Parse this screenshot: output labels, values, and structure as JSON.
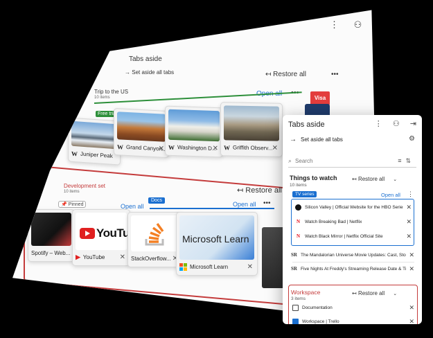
{
  "back": {
    "menu_icons": [
      "⋮",
      "⚇"
    ],
    "title": "Tabs aside",
    "set_aside_label": "Set aside all tabs",
    "restore_all": "Restore all",
    "more": "•••",
    "group1": {
      "name": "Trip to the US",
      "count": "10 items",
      "open_all": "Open all",
      "tag": "Free trials",
      "cards": [
        {
          "fav": "W",
          "title": "Juniper Peak",
          "thumb": "t-mtn"
        },
        {
          "fav": "W",
          "title": "Grand Canyon...",
          "thumb": "t-canyon"
        },
        {
          "fav": "W",
          "title": "Washington D...",
          "thumb": "t-capitol"
        },
        {
          "fav": "W",
          "title": "Griffith Observ...",
          "thumb": "t-griffith"
        }
      ]
    },
    "visa": "Visa",
    "group2": {
      "name": "Development set",
      "count": "10 items",
      "restore_all": "Restore all",
      "pinned": "Pinned",
      "open_all_1": "Open all",
      "docs_tag": "Docs",
      "open_all_2": "Open all",
      "cards": [
        {
          "title": "Spotify – Web...",
          "thumb": "t-spotify"
        },
        {
          "title": "YouTube",
          "thumb": "t-yt"
        },
        {
          "title": "StackOverflow...",
          "thumb": "t-so"
        },
        {
          "title": "Microsoft Learn",
          "thumb": "t-ms"
        }
      ],
      "yt_logo_text": "YouTube",
      "ms_logo_text": "Microsoft Learn"
    }
  },
  "panel": {
    "title": "Tabs aside",
    "set_aside_label": "Set aside all tabs",
    "search_placeholder": "Search",
    "group1": {
      "name": "Things to watch",
      "count": "10 items",
      "restore_all": "Restore all",
      "tag": "TV series",
      "open_all": "Open all",
      "items": [
        {
          "icon": "ic-sv",
          "glyph": "",
          "text": "Silicon Valley | Official Website for the HBO Series"
        },
        {
          "icon": "ic-nf",
          "glyph": "N",
          "text": "Watch Breaking Bad | Netflix"
        },
        {
          "icon": "ic-nf",
          "glyph": "N",
          "text": "Watch Black Mirror | Netflix Official Site"
        },
        {
          "icon": "ic-sr",
          "glyph": "SR",
          "text": "The Mandalorian Universe Movie Updates: Cast, Stor..."
        },
        {
          "icon": "ic-sr",
          "glyph": "SR",
          "text": "Five Nights At Freddy's Streaming Release Date & Ti..."
        }
      ]
    },
    "group2": {
      "name": "Workspace",
      "count": "3 items",
      "restore_all": "Restore all",
      "items": [
        {
          "icon": "ic-doc",
          "glyph": "",
          "text": "Documentation"
        },
        {
          "icon": "ic-tr",
          "glyph": "",
          "text": "Workspace | Trello"
        }
      ]
    }
  }
}
